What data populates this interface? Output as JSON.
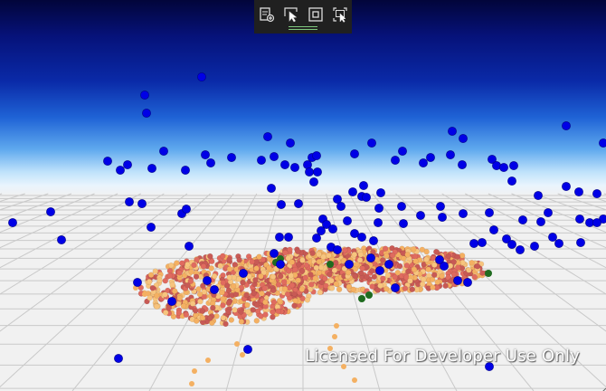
{
  "toolbar": {
    "buttons": [
      {
        "name": "add-layer-button",
        "icon": "add-layer-icon",
        "tooltip": ""
      },
      {
        "name": "select-pointer-button",
        "icon": "pointer-select-icon",
        "tooltip": ""
      },
      {
        "name": "zoom-extent-button",
        "icon": "zoom-extent-icon",
        "tooltip": ""
      },
      {
        "name": "box-select-button",
        "icon": "box-select-icon",
        "tooltip": ""
      }
    ]
  },
  "watermark": {
    "text": "Licensed For Developer Use Only"
  },
  "scene": {
    "sky_top_color": "#02053a",
    "horizon_color": "#e9f4fd",
    "ground_color": "#f1f1f1",
    "grid_line_color": "#c9c9c9",
    "sphere_color": "#0000e6",
    "cluster_colors": [
      "#f4b062",
      "#e06b5f",
      "#f7c47e",
      "#c85a55",
      "#1f6b1f"
    ]
  }
}
